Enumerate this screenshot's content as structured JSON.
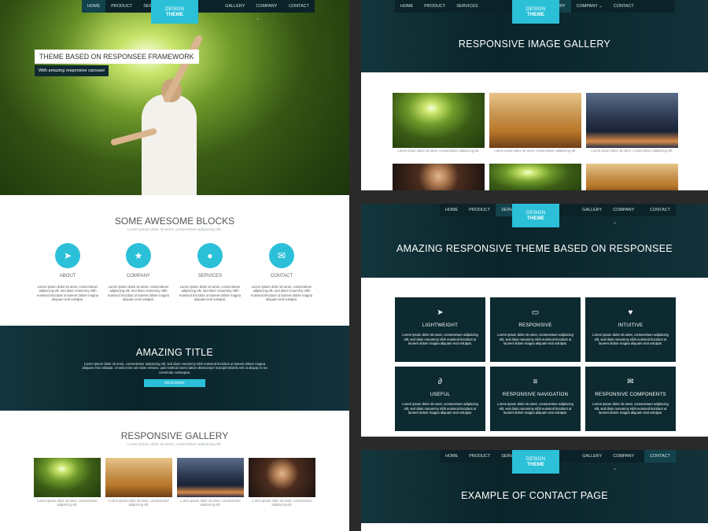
{
  "nav": {
    "home": "HOME",
    "product": "PRODUCT",
    "services": "SERVICES",
    "gallery": "GALLERY",
    "company": "COMPANY ⌄",
    "contact": "CONTACT"
  },
  "logo": {
    "line1": "DESIGN",
    "line2": "THEME"
  },
  "hero": {
    "title": "THEME BASED ON RESPONSEE FRAMEWORK",
    "subtitle": "With amazing responsive carousel"
  },
  "blocks": {
    "title": "SOME AWESOME BLOCKS",
    "subtitle": "Lorem ipsum dolor sit amet, consectetuer adipiscing elit.",
    "items": [
      {
        "label": "ABOUT",
        "icon": "paper-plane-icon",
        "glyph": "➤",
        "text": "Lorem ipsum dolor sit amet, consectetuer adipiscing elit, sed diam nonummy nibh euismod tincidunt ut laoreet dolore magna aliquam erat volutpat."
      },
      {
        "label": "COMPANY",
        "icon": "star-icon",
        "glyph": "★",
        "text": "Lorem ipsum dolor sit amet, consectetuer adipiscing elit, sed diam nonummy nibh euismod tincidunt ut laoreet dolore magna aliquam erat volutpat."
      },
      {
        "label": "SERVICES",
        "icon": "chat-icon",
        "glyph": "●",
        "text": "Lorem ipsum dolor sit amet, consectetuer adipiscing elit, sed diam nonummy nibh euismod tincidunt ut laoreet dolore magna aliquam erat volutpat."
      },
      {
        "label": "CONTACT",
        "icon": "envelope-icon",
        "glyph": "✉",
        "text": "Lorem ipsum dolor sit amet, consectetuer adipiscing elit, sed diam nonummy nibh euismod tincidunt ut laoreet dolore magna aliquam erat volutpat."
      }
    ]
  },
  "amazing": {
    "title": "AMAZING TITLE",
    "text": "Lorem ipsum dolor sit amet, consectetuer adipiscing elit, sed diam nonummy nibh euismod tincidunt ut laoreet dolore magna aliquam erat volutpat. Ut wisi enim ad minim veniam, quis nostrud exerci tation ullamcorper suscipit lobortis nisl ut aliquip ex ea commodo consequat.",
    "button": "READ MORE"
  },
  "gallery_left": {
    "title": "RESPONSIVE GALLERY",
    "subtitle": "Lorem ipsum dolor sit amet, consectetuer adipiscing elit.",
    "caption": "Lorem ipsum dolor sit amet, consectetuer adipiscing elit."
  },
  "gallery_page": {
    "title": "RESPONSIVE IMAGE GALLERY",
    "caption": "Lorem ipsum dolor sit amet, consectetuer adipiscing elit."
  },
  "theme_page": {
    "title": "AMAZING RESPONSIVE THEME BASED ON RESPONSEE",
    "card_text": "Lorem ipsum dolor sit amet, consectetuer adipiscing elit, sed diam nonummy nibh euismod tincidunt ut laoreet dolore magna aliquam erat volutpat.",
    "cards": [
      {
        "title": "LIGHTWEIGHT",
        "icon": "paper-plane-icon",
        "glyph": "➤"
      },
      {
        "title": "RESPONSIVE",
        "icon": "monitor-icon",
        "glyph": "▭"
      },
      {
        "title": "INTUITIVE",
        "icon": "heart-icon",
        "glyph": "♥"
      },
      {
        "title": "USEFUL",
        "icon": "paperclip-icon",
        "glyph": "∂"
      },
      {
        "title": "RESPONSIVE NAVIGATION",
        "icon": "menu-icon",
        "glyph": "≡"
      },
      {
        "title": "RESPONSIVE COMPONENTS",
        "icon": "envelope-icon",
        "glyph": "✉"
      }
    ]
  },
  "contact_page": {
    "title": "EXAMPLE OF CONTACT PAGE"
  }
}
